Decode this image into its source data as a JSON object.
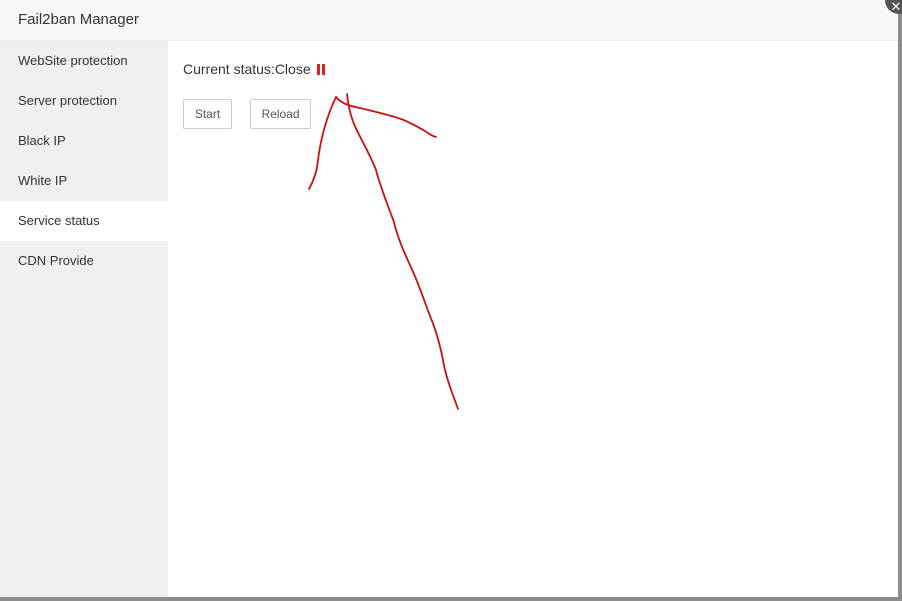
{
  "dialog": {
    "title": "Fail2ban Manager",
    "close_icon": "close-icon"
  },
  "sidebar": {
    "items": [
      {
        "label": "WebSite protection",
        "active": false
      },
      {
        "label": "Server protection",
        "active": false
      },
      {
        "label": "Black IP",
        "active": false
      },
      {
        "label": "White IP",
        "active": false
      },
      {
        "label": "Service status",
        "active": true
      },
      {
        "label": "CDN Provide",
        "active": false
      }
    ]
  },
  "content": {
    "status_text": "Current status:Close",
    "status_icon": "pause-icon",
    "status_color": "#dd2222",
    "start_label": "Start",
    "reload_label": "Reload"
  },
  "annotation": {
    "type": "hand-drawn-arrow",
    "color": "#cc1111"
  }
}
